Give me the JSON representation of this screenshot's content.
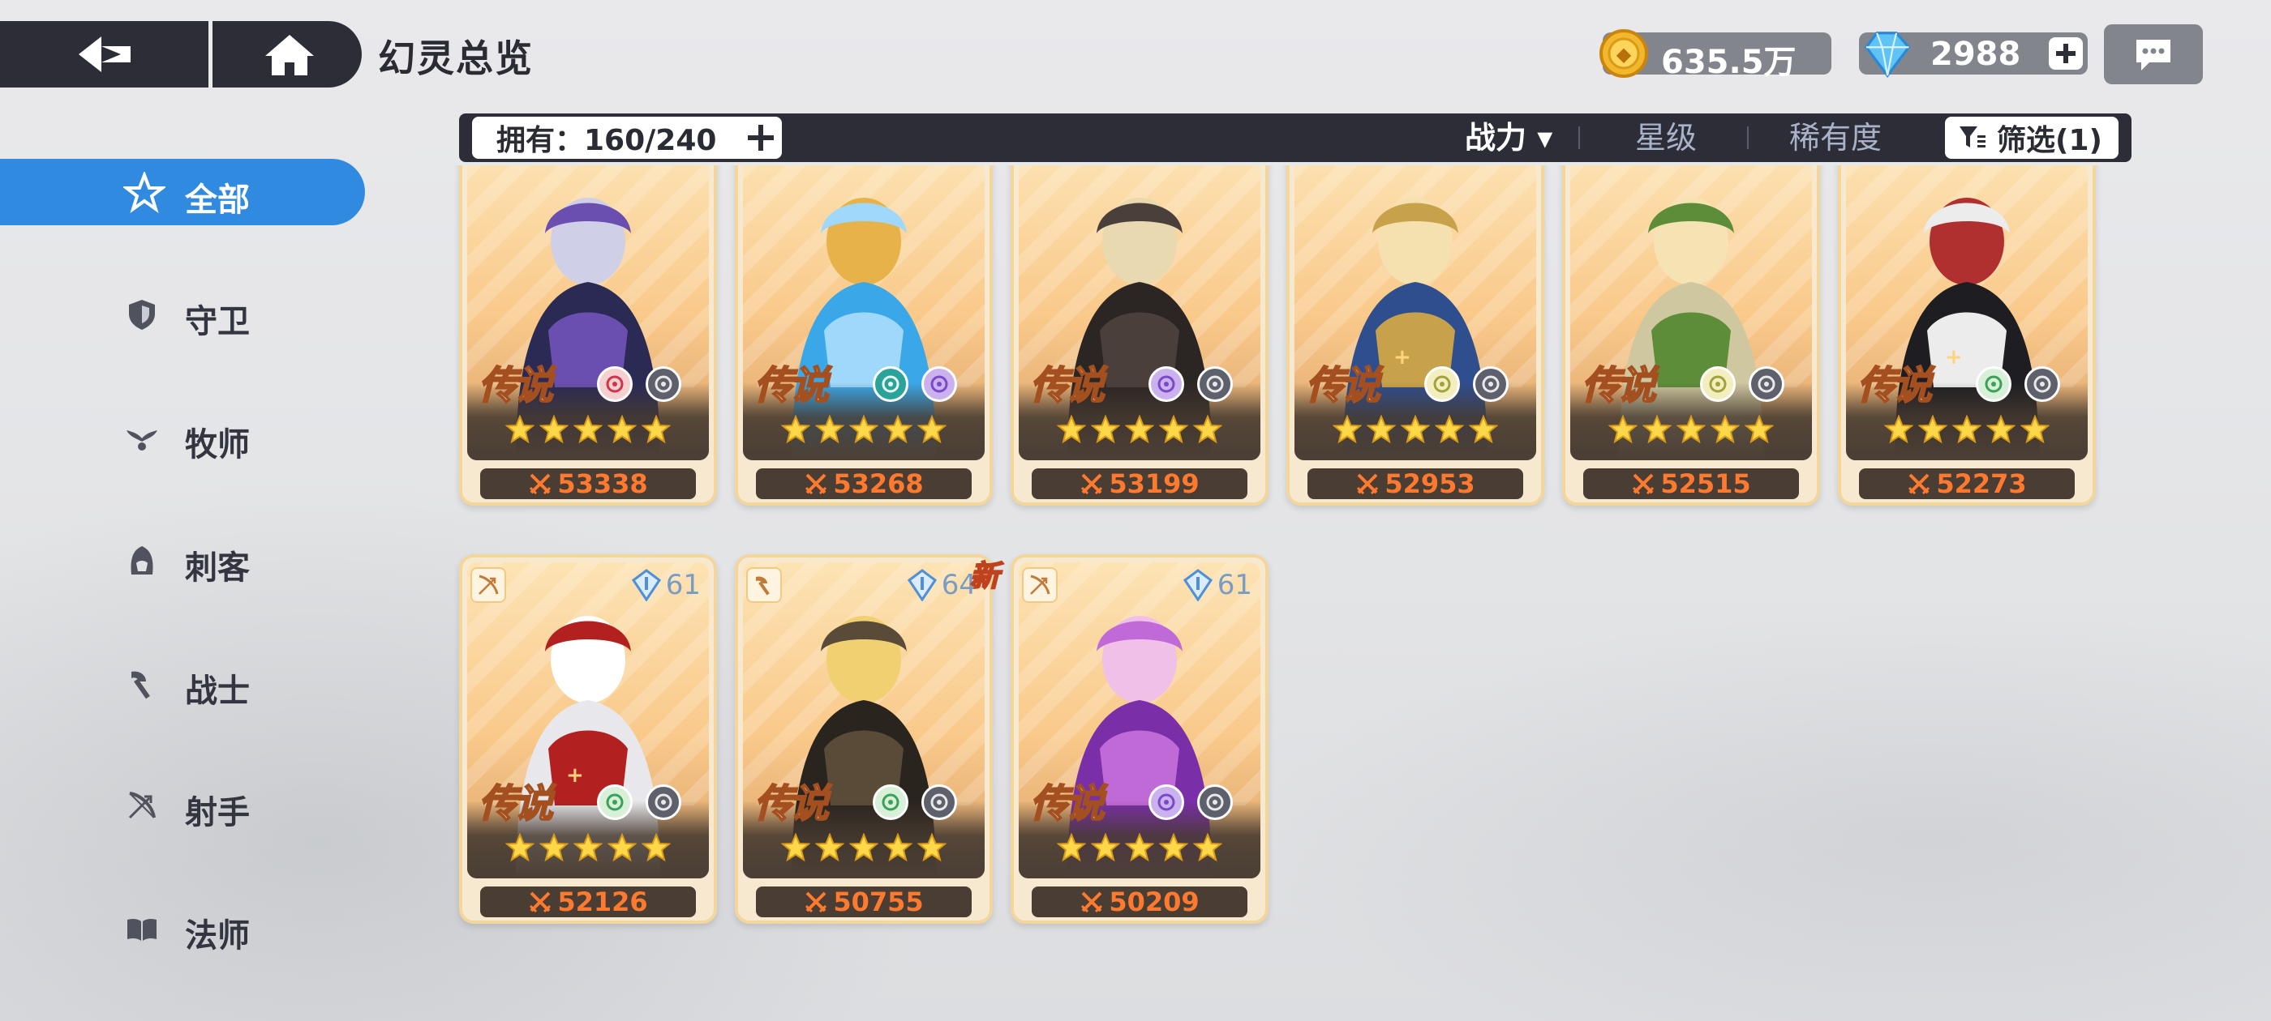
{
  "header": {
    "title": "幻灵总览",
    "gold": "635.5万",
    "gems": "2988"
  },
  "filterbar": {
    "owned": "拥有：160/240",
    "sort_power": "战力 ▾",
    "sort_star": "星级",
    "sort_rarity": "稀有度",
    "filter": "筛选(1)"
  },
  "sidebar": {
    "items": [
      {
        "label": "全部",
        "icon": "all-star-icon",
        "active": true
      },
      {
        "label": "守卫",
        "icon": "shield-icon",
        "active": false
      },
      {
        "label": "牧师",
        "icon": "priest-wings-icon",
        "active": false
      },
      {
        "label": "刺客",
        "icon": "assassin-hood-icon",
        "active": false
      },
      {
        "label": "战士",
        "icon": "axe-icon",
        "active": false
      },
      {
        "label": "射手",
        "icon": "bow-icon",
        "active": false
      },
      {
        "label": "法师",
        "icon": "book-icon",
        "active": false
      }
    ]
  },
  "cards": [
    {
      "power": "53338",
      "rarity": "传说",
      "plus": false,
      "stars": 5,
      "elements": [
        "swirl-red",
        "void-gray"
      ],
      "level": "",
      "new": false
    },
    {
      "power": "53268",
      "rarity": "传说",
      "plus": false,
      "stars": 5,
      "elements": [
        "infinity-teal",
        "void-purple"
      ],
      "level": "",
      "new": false
    },
    {
      "power": "53199",
      "rarity": "传说",
      "plus": false,
      "stars": 5,
      "elements": [
        "void-purple",
        "swirl-gray"
      ],
      "level": "",
      "new": false
    },
    {
      "power": "52953",
      "rarity": "传说",
      "plus": true,
      "stars": 5,
      "elements": [
        "wings-olive",
        "void-gray"
      ],
      "level": "",
      "new": false
    },
    {
      "power": "52515",
      "rarity": "传说",
      "plus": false,
      "stars": 5,
      "elements": [
        "wings-olive",
        "flame-gray"
      ],
      "level": "",
      "new": false
    },
    {
      "power": "52273",
      "rarity": "传说",
      "plus": true,
      "stars": 5,
      "elements": [
        "leaf-green",
        "void-gray"
      ],
      "level": "",
      "new": false
    },
    {
      "power": "52126",
      "rarity": "传说",
      "plus": true,
      "stars": 5,
      "elements": [
        "leaf-green",
        "infinity-gray"
      ],
      "level": "61",
      "class": "bow-icon",
      "new": false
    },
    {
      "power": "50755",
      "rarity": "传说",
      "plus": false,
      "stars": 5,
      "elements": [
        "leaf-green",
        "infinity-gray"
      ],
      "level": "64",
      "class": "axe-icon",
      "new": true,
      "new_label": "新"
    },
    {
      "power": "50209",
      "rarity": "传说",
      "plus": false,
      "stars": 5,
      "elements": [
        "void-purple",
        "infinity-gray"
      ],
      "level": "61",
      "class": "bow-icon",
      "new": false
    }
  ],
  "colors": {
    "accent": "#2f8ae0",
    "bar_dark": "#2c2d36",
    "power_orange": "#ff7a2e",
    "card_gold": "#f3d69c"
  }
}
